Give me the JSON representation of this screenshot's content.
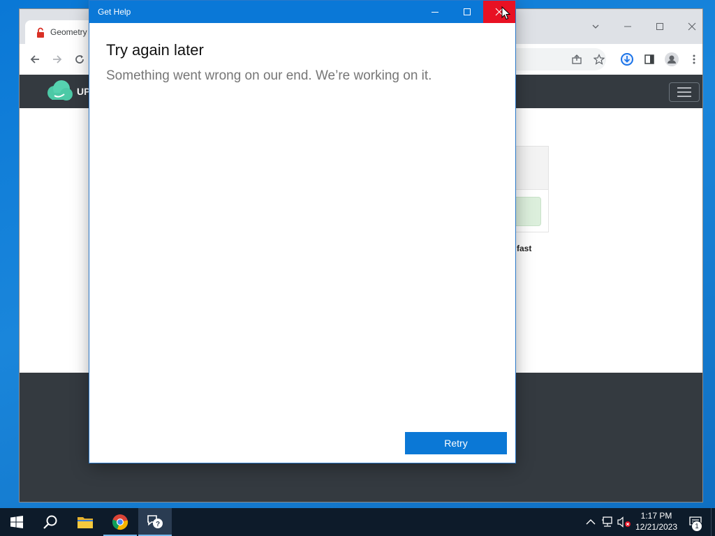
{
  "browser": {
    "tab_title": "Geometry",
    "site_logo_text": "UP",
    "card_caption": "fast"
  },
  "dialog": {
    "title": "Get Help",
    "heading": "Try again later",
    "message": "Something went wrong on our end. We’re working on it.",
    "retry_label": "Retry"
  },
  "taskbar": {
    "time": "1:17 PM",
    "date": "12/21/2023",
    "notification_count": "1"
  },
  "colors": {
    "dialog_titlebar": "#0a78d7",
    "close_hover": "#e81123",
    "retry_button": "#0b78d6",
    "taskbar": "#0d1b2a"
  },
  "icons": [
    "start-icon",
    "search-icon",
    "file-explorer-icon",
    "chrome-icon",
    "get-help-icon",
    "chevron-up-icon",
    "network-icon",
    "volume-muted-icon",
    "notification-icon"
  ]
}
